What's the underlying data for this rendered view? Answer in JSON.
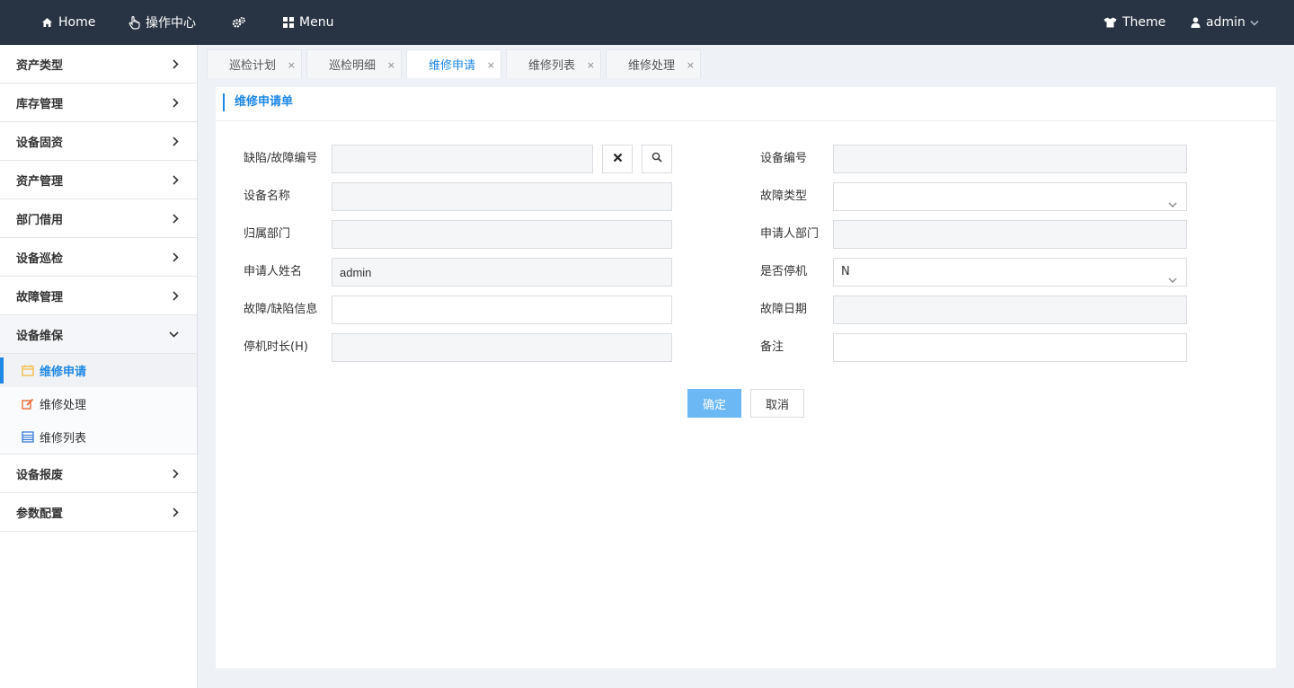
{
  "topbar": {
    "home": "Home",
    "ops_center": "操作中心",
    "menu": "Menu",
    "theme": "Theme",
    "user": "admin"
  },
  "sidebar": {
    "groups": [
      {
        "label": "资产类型"
      },
      {
        "label": "库存管理"
      },
      {
        "label": "设备固资"
      },
      {
        "label": "资产管理"
      },
      {
        "label": "部门借用"
      },
      {
        "label": "设备巡检"
      },
      {
        "label": "故障管理"
      },
      {
        "label": "设备维保"
      },
      {
        "label": "设备报废"
      },
      {
        "label": "参数配置"
      }
    ],
    "subitems": [
      {
        "label": "维修申请"
      },
      {
        "label": "维修处理"
      },
      {
        "label": "维修列表"
      }
    ]
  },
  "tabs": [
    {
      "label": "巡检计划"
    },
    {
      "label": "巡检明细"
    },
    {
      "label": "维修申请"
    },
    {
      "label": "维修列表"
    },
    {
      "label": "维修处理"
    }
  ],
  "tab_close": "×",
  "panel": {
    "title": "维修申请单"
  },
  "form": {
    "defect_no": {
      "label": "缺陷/故障编号",
      "value": ""
    },
    "device_no": {
      "label": "设备编号",
      "value": ""
    },
    "device_name": {
      "label": "设备名称",
      "value": ""
    },
    "fault_type": {
      "label": "故障类型",
      "value": ""
    },
    "dept": {
      "label": "归属部门",
      "value": ""
    },
    "applicant_dept": {
      "label": "申请人部门",
      "value": ""
    },
    "applicant_name": {
      "label": "申请人姓名",
      "value": "admin"
    },
    "is_stopped": {
      "label": "是否停机",
      "value": "N"
    },
    "fault_info": {
      "label": "故障/缺陷信息",
      "value": ""
    },
    "fault_date": {
      "label": "故障日期",
      "value": ""
    },
    "downtime": {
      "label": "停机时长(H)",
      "value": ""
    },
    "remark": {
      "label": "备注",
      "value": ""
    }
  },
  "buttons": {
    "confirm": "确定",
    "cancel": "取消"
  },
  "colors": {
    "topbar": "#283444",
    "accent": "#1e88e5",
    "primary_button": "#6cb8f5"
  }
}
